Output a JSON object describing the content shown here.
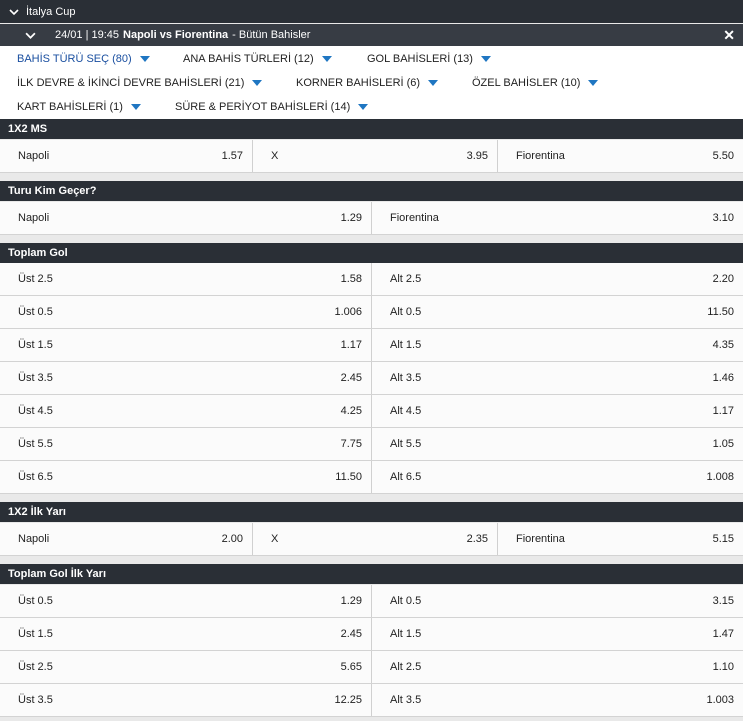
{
  "league": {
    "title": "İtalya Cup"
  },
  "match": {
    "datetime": "24/01 | 19:45",
    "teams": "Napoli vs Fiorentina",
    "subtitle": "- Bütün Bahisler",
    "close_label": "✕"
  },
  "filters": [
    {
      "label": "BAHİS TÜRÜ SEÇ (80)"
    },
    {
      "label": "ANA BAHİS TÜRLERİ (12)"
    },
    {
      "label": "GOL BAHİSLERİ (13)"
    },
    {
      "label": "İLK DEVRE & İKİNCİ DEVRE BAHİSLERİ (21)"
    },
    {
      "label": "KORNER BAHİSLERİ (6)"
    },
    {
      "label": "ÖZEL BAHİSLER (10)"
    },
    {
      "label": "KART BAHİSLERİ (1)"
    },
    {
      "label": "SÜRE & PERİYOT BAHİSLERİ (14)"
    }
  ],
  "sections": {
    "s1x2": {
      "title": "1X2 MS",
      "row": [
        {
          "label": "Napoli",
          "odd": "1.57"
        },
        {
          "label": "X",
          "odd": "3.95"
        },
        {
          "label": "Fiorentina",
          "odd": "5.50"
        }
      ]
    },
    "qualify": {
      "title": "Turu Kim Geçer?",
      "row": [
        {
          "label": "Napoli",
          "odd": "1.29"
        },
        {
          "label": "Fiorentina",
          "odd": "3.10"
        }
      ]
    },
    "totals": {
      "title": "Toplam Gol",
      "rows": [
        [
          {
            "label": "Üst 2.5",
            "odd": "1.58"
          },
          {
            "label": "Alt 2.5",
            "odd": "2.20"
          }
        ],
        [
          {
            "label": "Üst 0.5",
            "odd": "1.006"
          },
          {
            "label": "Alt 0.5",
            "odd": "11.50"
          }
        ],
        [
          {
            "label": "Üst 1.5",
            "odd": "1.17"
          },
          {
            "label": "Alt 1.5",
            "odd": "4.35"
          }
        ],
        [
          {
            "label": "Üst 3.5",
            "odd": "2.45"
          },
          {
            "label": "Alt 3.5",
            "odd": "1.46"
          }
        ],
        [
          {
            "label": "Üst 4.5",
            "odd": "4.25"
          },
          {
            "label": "Alt 4.5",
            "odd": "1.17"
          }
        ],
        [
          {
            "label": "Üst 5.5",
            "odd": "7.75"
          },
          {
            "label": "Alt 5.5",
            "odd": "1.05"
          }
        ],
        [
          {
            "label": "Üst 6.5",
            "odd": "11.50"
          },
          {
            "label": "Alt 6.5",
            "odd": "1.008"
          }
        ]
      ]
    },
    "ht1x2": {
      "title": "1X2 İlk Yarı",
      "row": [
        {
          "label": "Napoli",
          "odd": "2.00"
        },
        {
          "label": "X",
          "odd": "2.35"
        },
        {
          "label": "Fiorentina",
          "odd": "5.15"
        }
      ]
    },
    "httotals": {
      "title": "Toplam Gol İlk Yarı",
      "rows": [
        [
          {
            "label": "Üst 0.5",
            "odd": "1.29"
          },
          {
            "label": "Alt 0.5",
            "odd": "3.15"
          }
        ],
        [
          {
            "label": "Üst 1.5",
            "odd": "2.45"
          },
          {
            "label": "Alt 1.5",
            "odd": "1.47"
          }
        ],
        [
          {
            "label": "Üst 2.5",
            "odd": "5.65"
          },
          {
            "label": "Alt 2.5",
            "odd": "1.10"
          }
        ],
        [
          {
            "label": "Üst 3.5",
            "odd": "12.25"
          },
          {
            "label": "Alt 3.5",
            "odd": "1.003"
          }
        ]
      ]
    }
  }
}
